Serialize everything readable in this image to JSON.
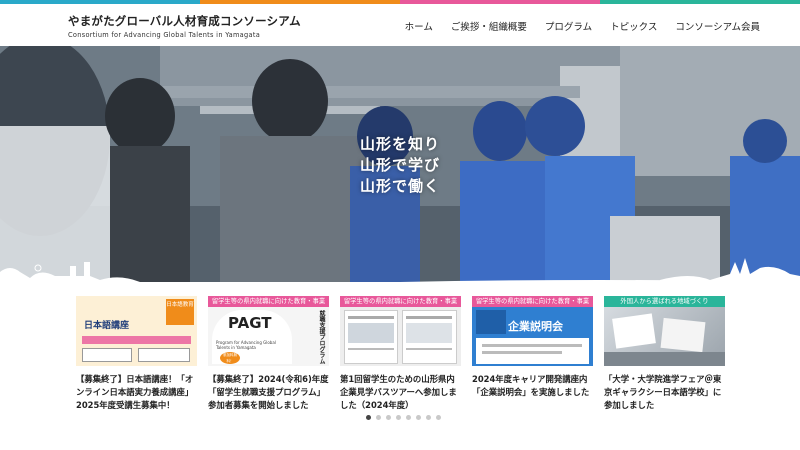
{
  "brand_colors": [
    "#2aa9c9",
    "#f08c1a",
    "#e8589a",
    "#2ab59a"
  ],
  "header": {
    "logo_jp": "やまがたグローバル人材育成コンソーシアム",
    "logo_en": "Consortium for Advancing Global Talents in Yamagata"
  },
  "nav": [
    "ホーム",
    "ご挨拶・組織概要",
    "プログラム",
    "トピックス",
    "コンソーシアム会員"
  ],
  "hero": {
    "lines": [
      "山形を知り",
      "山形で学び",
      "山形で働く"
    ]
  },
  "cards": [
    {
      "tag": "",
      "tag_color": "#f08c1a",
      "thumb_title": "日本語講座",
      "thumb_badge": "日本語教育",
      "title": "【募集終了】日本語講座！「オンライン日本語実力養成講座」2025年度受講生募集中！"
    },
    {
      "tag": "留学生等の県内就職に向けた教育・事業",
      "tag_color": "#e8589a",
      "thumb_title": "PAGT",
      "thumb_badge": "就職支援プログラム",
      "thumb_sub": "Program for Advancing Global Talents in Yamagata",
      "thumb_free": "参加料無料！",
      "title": "【募集終了】2024(令和6)年度「留学生就職支援プログラム」参加者募集を開始しました"
    },
    {
      "tag": "留学生等の県内就職に向けた教育・事業",
      "tag_color": "#e8589a",
      "title": "第1回留学生のための山形県内企業見学バスツアーへ参加しました（2024年度）"
    },
    {
      "tag": "留学生等の県内就職に向けた教育・事業",
      "tag_color": "#e8589a",
      "thumb_title": "企業説明会",
      "title": "2024年度キャリア開発講座内「企業説明会」を実施しました"
    },
    {
      "tag": "外国人から選ばれる地域づくり",
      "tag_color": "#2ab59a",
      "title": "「大学・大学院進学フェア＠東京ギャラクシー日本語学校」に参加しました"
    }
  ],
  "pagination": {
    "count": 8,
    "active": 0
  }
}
